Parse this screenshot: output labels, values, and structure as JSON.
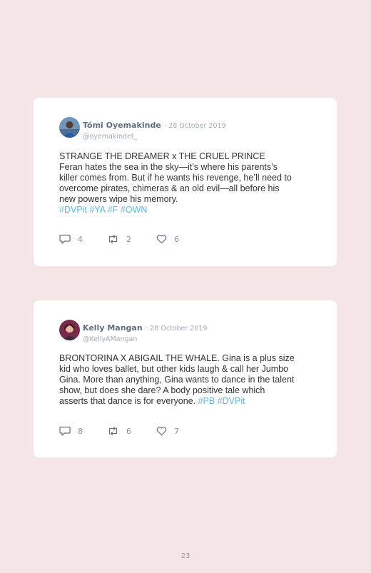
{
  "tweets": [
    {
      "name": "Tómi Oyemakinde",
      "date": "· 28 October 2019",
      "handle": "@oyemakindet_",
      "lines": [
        "STRANGE THE DREAMER x THE CRUEL PRINCE",
        "Feran hates the sea in the sky—it’s where his parents’s",
        "killer comes from. But if he wants his revenge, he’ll need to",
        "overcome pirates, chimeras & an old evil—all before his",
        "new powers wipe his memory."
      ],
      "hashtags": "#DVPit #YA #F #OWN",
      "replies": "4",
      "retweets": "2",
      "likes": "6"
    },
    {
      "name": "Kelly Mangan",
      "date": "· 28 October 2019",
      "handle": "@KellyAMangan",
      "lines": [
        "BRONTORINA X ABIGAIL THE WHALE. Gina is a plus size",
        "kid who loves ballet, but other kids laugh & call her Jumbo",
        "Gina. More than anything, Gina wants to dance in the talent",
        "show, but does she dare? A body positive tale which",
        "asserts that dance is for everyone."
      ],
      "hashtags": "#PB #DVPit",
      "replies": "8",
      "retweets": "6",
      "likes": "7"
    }
  ],
  "page_number": "23",
  "colors": {
    "background": "#f4e6e6",
    "card": "#ffffff",
    "hashtag": "#5db8e4",
    "name": "#5f6f7f",
    "meta": "#a3adb6"
  },
  "icons": [
    "reply-icon",
    "retweet-icon",
    "like-icon"
  ]
}
